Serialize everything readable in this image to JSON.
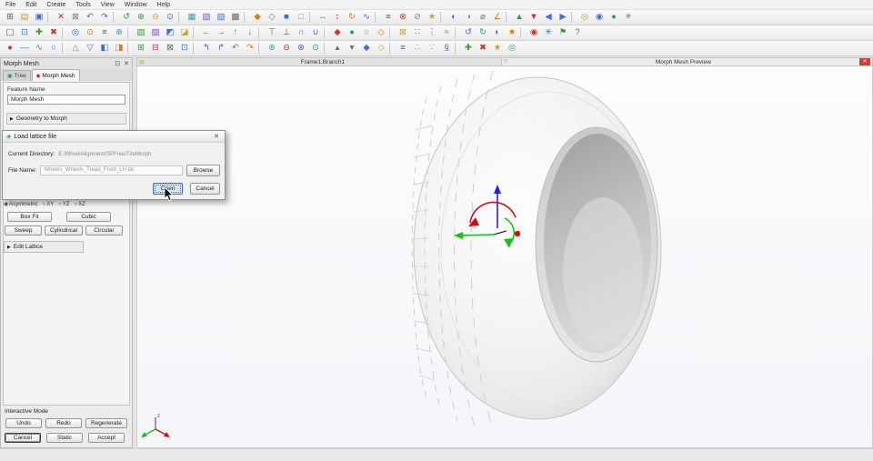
{
  "colors": {
    "accent_blue": "#2f6fd0",
    "open_button_bg": "#d6e7fa",
    "close_red": "#d23b3b",
    "axis_green": "#18c418",
    "axis_blue": "#2222dd",
    "axis_red": "#cc1111"
  },
  "menu": {
    "items": [
      "File",
      "Edit",
      "Create",
      "Tools",
      "View",
      "Window",
      "Help"
    ]
  },
  "toolbars": {
    "row1": [
      {
        "n": "new-icon",
        "g": "⊞",
        "c": "#5b5b5b"
      },
      {
        "n": "open-icon",
        "g": "▤",
        "c": "#c9a227"
      },
      {
        "n": "save-icon",
        "g": "▣",
        "c": "#3a6fd8"
      },
      {
        "n": "toolbar-separator",
        "sep": 1
      },
      {
        "n": "delete-icon",
        "g": "✕",
        "c": "#cc3333"
      },
      {
        "n": "close-entity-icon",
        "g": "⊠",
        "c": "#777777"
      },
      {
        "n": "undo-icon",
        "g": "↶",
        "c": "#3a6fd8"
      },
      {
        "n": "redo-icon",
        "g": "↷",
        "c": "#3a6fd8"
      },
      {
        "n": "toolbar-separator",
        "sep": 1
      },
      {
        "n": "refresh-icon",
        "g": "↺",
        "c": "#2f9e44"
      },
      {
        "n": "zoom-in-icon",
        "g": "⊕",
        "c": "#2f9e44"
      },
      {
        "n": "zoom-out-icon",
        "g": "⊖",
        "c": "#c9a227"
      },
      {
        "n": "zoom-fit-icon",
        "g": "⊙",
        "c": "#3a6fd8"
      },
      {
        "n": "toolbar-separator",
        "sep": 1
      },
      {
        "n": "mesh-icon",
        "g": "▦",
        "c": "#38a3a5"
      },
      {
        "n": "shaded-view-icon",
        "g": "▧",
        "c": "#7a4fc0"
      },
      {
        "n": "wireframe-icon",
        "g": "▨",
        "c": "#3a6fd8"
      },
      {
        "n": "hidden-line-icon",
        "g": "▩",
        "c": "#666666"
      },
      {
        "n": "toolbar-separator",
        "sep": 1
      },
      {
        "n": "entity-icon",
        "g": "◆",
        "c": "#e07b00"
      },
      {
        "n": "surface-icon",
        "g": "◇",
        "c": "#2f9e44"
      },
      {
        "n": "solid-icon",
        "g": "■",
        "c": "#3a6fd8"
      },
      {
        "n": "sheet-icon",
        "g": "□",
        "c": "#888888"
      },
      {
        "n": "toolbar-separator",
        "sep": 1
      },
      {
        "n": "translate-icon",
        "g": "↔",
        "c": "#2f9e44"
      },
      {
        "n": "stretch-icon",
        "g": "↕",
        "c": "#cc3333"
      },
      {
        "n": "rotate-icon",
        "g": "↻",
        "c": "#e07b00"
      },
      {
        "n": "curve-icon",
        "g": "∿",
        "c": "#7a4fc0"
      },
      {
        "n": "toolbar-separator",
        "sep": 1
      },
      {
        "n": "list-icon",
        "g": "≡",
        "c": "#666666"
      },
      {
        "n": "remove-icon",
        "g": "⊗",
        "c": "#cc3333"
      },
      {
        "n": "disable-icon",
        "g": "⊘",
        "c": "#888888"
      },
      {
        "n": "favorite-icon",
        "g": "★",
        "c": "#c9a227"
      },
      {
        "n": "toolbar-separator",
        "sep": 1
      },
      {
        "n": "section-view-icon",
        "g": "◐",
        "c": "#3a6fd8"
      },
      {
        "n": "half-view-icon",
        "g": "◑",
        "c": "#38a3a5"
      },
      {
        "n": "diameter-icon",
        "g": "⌀",
        "c": "#666666"
      },
      {
        "n": "angle-icon",
        "g": "∠",
        "c": "#e07b00"
      },
      {
        "n": "toolbar-separator",
        "sep": 1
      },
      {
        "n": "move-up-icon",
        "g": "▲",
        "c": "#2f9e44"
      },
      {
        "n": "move-down-icon",
        "g": "▼",
        "c": "#cc3333"
      },
      {
        "n": "back-icon",
        "g": "◀",
        "c": "#3a6fd8"
      },
      {
        "n": "forward-icon",
        "g": "▶",
        "c": "#3a6fd8"
      },
      {
        "n": "toolbar-separator",
        "sep": 1
      },
      {
        "n": "lamp-icon",
        "g": "◎",
        "c": "#c9a227"
      },
      {
        "n": "camera-icon",
        "g": "◉",
        "c": "#3a6fd8"
      },
      {
        "n": "render-icon",
        "g": "●",
        "c": "#2f9e44"
      },
      {
        "n": "settings-icon",
        "g": "✳",
        "c": "#777777"
      }
    ],
    "row2": [
      {
        "n": "select-icon",
        "g": "▢",
        "c": "#5b5b5b"
      },
      {
        "n": "box-select-icon",
        "g": "⊡",
        "c": "#3a6fd8"
      },
      {
        "n": "add-icon",
        "g": "✚",
        "c": "#2f9e44"
      },
      {
        "n": "erase-icon",
        "g": "✖",
        "c": "#cc3333"
      },
      {
        "n": "toolbar-separator",
        "sep": 1
      },
      {
        "n": "target-icon",
        "g": "◎",
        "c": "#3a6fd8"
      },
      {
        "n": "snap-icon",
        "g": "⊙",
        "c": "#e07b00"
      },
      {
        "n": "layers-icon",
        "g": "≡",
        "c": "#666666"
      },
      {
        "n": "merge-icon",
        "g": "⊕",
        "c": "#38a3a5"
      },
      {
        "n": "toolbar-separator",
        "sep": 1
      },
      {
        "n": "fill-icon",
        "g": "▧",
        "c": "#2f9e44"
      },
      {
        "n": "hatch-icon",
        "g": "▨",
        "c": "#7a4fc0"
      },
      {
        "n": "corner-icon",
        "g": "◩",
        "c": "#3a6fd8"
      },
      {
        "n": "shade-icon",
        "g": "◪",
        "c": "#c9a227"
      },
      {
        "n": "toolbar-separator",
        "sep": 1
      },
      {
        "n": "prev-icon",
        "g": "←",
        "c": "#3a6fd8"
      },
      {
        "n": "next-icon",
        "g": "→",
        "c": "#3a6fd8"
      },
      {
        "n": "raise-icon",
        "g": "↑",
        "c": "#2f9e44"
      },
      {
        "n": "lower-icon",
        "g": "↓",
        "c": "#cc3333"
      },
      {
        "n": "toolbar-separator",
        "sep": 1
      },
      {
        "n": "top-view-icon",
        "g": "⊤",
        "c": "#666666"
      },
      {
        "n": "bottom-view-icon",
        "g": "⊥",
        "c": "#666666"
      },
      {
        "n": "intersect-icon",
        "g": "∩",
        "c": "#3a6fd8"
      },
      {
        "n": "union-icon",
        "g": "∪",
        "c": "#3a6fd8"
      },
      {
        "n": "toolbar-separator",
        "sep": 1
      },
      {
        "n": "keypoint-icon",
        "g": "◆",
        "c": "#cc3333"
      },
      {
        "n": "node-icon",
        "g": "●",
        "c": "#2f9e44"
      },
      {
        "n": "free-node-icon",
        "g": "○",
        "c": "#888888"
      },
      {
        "n": "marker-icon",
        "g": "◇",
        "c": "#e07b00"
      },
      {
        "n": "toolbar-separator",
        "sep": 1
      },
      {
        "n": "lock-icon",
        "g": "⊠",
        "c": "#c9a227"
      },
      {
        "n": "pattern-icon",
        "g": "∷",
        "c": "#666666"
      },
      {
        "n": "more-icon",
        "g": "⋮",
        "c": "#666666"
      },
      {
        "n": "smooth-icon",
        "g": "≈",
        "c": "#38a3a5"
      },
      {
        "n": "toolbar-separator",
        "sep": 1
      },
      {
        "n": "replay-icon",
        "g": "↺",
        "c": "#7a4fc0"
      },
      {
        "n": "regenerate-icon",
        "g": "↻",
        "c": "#2f9e44"
      },
      {
        "n": "contrast-icon",
        "g": "◐",
        "c": "#3a6fd8"
      },
      {
        "n": "highlight-icon",
        "g": "★",
        "c": "#e07b00"
      },
      {
        "n": "toolbar-separator",
        "sep": 1
      },
      {
        "n": "pin-icon",
        "g": "◉",
        "c": "#cc3333"
      },
      {
        "n": "anchor-icon",
        "g": "✳",
        "c": "#3a6fd8"
      },
      {
        "n": "flag-icon",
        "g": "⚑",
        "c": "#2f9e44"
      },
      {
        "n": "help-icon",
        "g": "?",
        "c": "#3a6fd8"
      }
    ],
    "row3": [
      {
        "n": "point-icon",
        "g": "●",
        "c": "#cc3333"
      },
      {
        "n": "line-icon",
        "g": "—",
        "c": "#3a6fd8"
      },
      {
        "n": "spline-icon",
        "g": "∿",
        "c": "#2f9e44"
      },
      {
        "n": "circle-icon",
        "g": "○",
        "c": "#3a6fd8"
      },
      {
        "n": "toolbar-separator",
        "sep": 1
      },
      {
        "n": "triangle-icon",
        "g": "△",
        "c": "#38a3a5"
      },
      {
        "n": "inverted-triangle-icon",
        "g": "▽",
        "c": "#7a4fc0"
      },
      {
        "n": "half-left-icon",
        "g": "◧",
        "c": "#3a6fd8"
      },
      {
        "n": "half-right-icon",
        "g": "◨",
        "c": "#e07b00"
      },
      {
        "n": "toolbar-separator",
        "sep": 1
      },
      {
        "n": "quad-mesh-icon",
        "g": "⊞",
        "c": "#2f9e44"
      },
      {
        "n": "row-delete-icon",
        "g": "⊟",
        "c": "#cc3333"
      },
      {
        "n": "cell-delete-icon",
        "g": "⊠",
        "c": "#666666"
      },
      {
        "n": "cell-icon",
        "g": "⊡",
        "c": "#3a6fd8"
      },
      {
        "n": "toolbar-separator",
        "sep": 1
      },
      {
        "n": "branch-left-icon",
        "g": "↰",
        "c": "#3a6fd8"
      },
      {
        "n": "branch-right-icon",
        "g": "↱",
        "c": "#3a6fd8"
      },
      {
        "n": "roll-back-icon",
        "g": "↶",
        "c": "#2f9e44"
      },
      {
        "n": "roll-forward-icon",
        "g": "↷",
        "c": "#e07b00"
      },
      {
        "n": "toolbar-separator",
        "sep": 1
      },
      {
        "n": "insert-icon",
        "g": "⊕",
        "c": "#38a3a5"
      },
      {
        "n": "subtract-icon",
        "g": "⊖",
        "c": "#cc3333"
      },
      {
        "n": "exclude-icon",
        "g": "⊗",
        "c": "#7a4fc0"
      },
      {
        "n": "include-icon",
        "g": "⊙",
        "c": "#2f9e44"
      },
      {
        "n": "toolbar-separator",
        "sep": 1
      },
      {
        "n": "nudge-up-icon",
        "g": "▴",
        "c": "#666666"
      },
      {
        "n": "nudge-down-icon",
        "g": "▾",
        "c": "#666666"
      },
      {
        "n": "vertex-icon",
        "g": "◆",
        "c": "#3a6fd8"
      },
      {
        "n": "midpoint-icon",
        "g": "◇",
        "c": "#c9a227"
      },
      {
        "n": "toolbar-separator",
        "sep": 1
      },
      {
        "n": "stack-icon",
        "g": "≡",
        "c": "#3a6fd8"
      },
      {
        "n": "scatter-icon",
        "g": "∴",
        "c": "#888888"
      },
      {
        "n": "gather-icon",
        "g": "∵",
        "c": "#888888"
      },
      {
        "n": "section-mark-icon",
        "g": "§",
        "c": "#7a4fc0"
      },
      {
        "n": "toolbar-separator",
        "sep": 1
      },
      {
        "n": "plus-tool-icon",
        "g": "✚",
        "c": "#2f9e44"
      },
      {
        "n": "cross-tool-icon",
        "g": "✖",
        "c": "#cc3333"
      },
      {
        "n": "star-tool-icon",
        "g": "★",
        "c": "#c9a227"
      },
      {
        "n": "ring-tool-icon",
        "g": "◎",
        "c": "#38a3a5"
      }
    ]
  },
  "panel": {
    "title": "Morph Mesh",
    "tabs": [
      {
        "label": "Tree"
      },
      {
        "label": "Morph Mesh"
      }
    ],
    "feature_name_label": "Feature Name",
    "feature_name_value": "Morph Mesh",
    "geometry_section_label": "Geometry to Morph",
    "asymmetric_label": "Asymmetric",
    "axis_options": [
      "XY",
      "YZ",
      "XZ"
    ],
    "fit_buttons": [
      "Box Fit",
      "Cubic"
    ],
    "lattice_buttons": [
      "Sweep",
      "Cylindrical",
      "Circular"
    ],
    "edit_lattice_label": "Edit Lattice",
    "interactive_mode_label": "Interactive Mode",
    "history_buttons": [
      "Undo",
      "Redo",
      "Regenerate"
    ],
    "commit_buttons": [
      "Cancel",
      "Static",
      "Accept"
    ]
  },
  "dialog": {
    "title": "Load lattice file",
    "current_directory_label": "Current Directory:",
    "current_directory_value": "E:/WheelAlignment/SPFree/TireMorph",
    "file_name_label": "File Name:",
    "file_name_value": "Wheels_Wheels_Tread_Front_LH.lat",
    "browse_label": "Browse",
    "open_label": "Open",
    "cancel_label": "Cancel"
  },
  "viewport": {
    "tab_title": "Frame1.Branch1",
    "preview_title": "Morph Mesh Preview"
  },
  "icons": {
    "panel_float": "⊡",
    "panel_close": "✕",
    "tab_tree_icon": "▣",
    "tab_morph_icon": "◆",
    "section_arrow": "▶",
    "radio_on": "◉",
    "radio_off": "○",
    "dialog_icon": "◈",
    "dialog_close": "✕",
    "vp_tab_icon": "▤",
    "vp_marker": "▽",
    "vp_close": "✕"
  }
}
